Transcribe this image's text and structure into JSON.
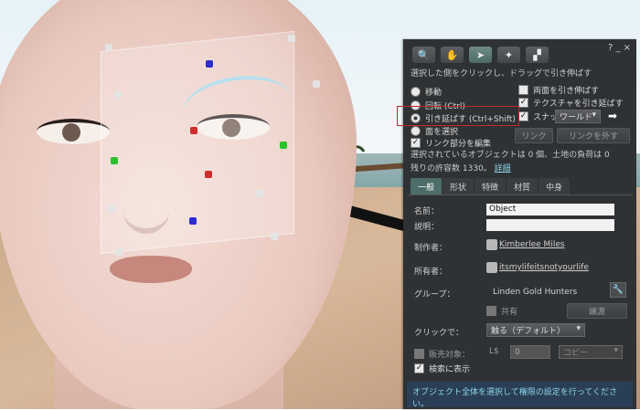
{
  "window": {
    "controls": "? _ ×"
  },
  "toolbar": {
    "tools": [
      {
        "icon": "magnifier-icon",
        "glyph": "🔍"
      },
      {
        "icon": "hand-icon",
        "glyph": "✋"
      },
      {
        "icon": "pointer-icon",
        "glyph": "➤"
      },
      {
        "icon": "wand-icon",
        "glyph": "✦"
      },
      {
        "icon": "land-icon",
        "glyph": "▞"
      }
    ]
  },
  "hint": "選択した側をクリックし、ドラッグで引き伸ばす",
  "modes": {
    "move": "移動",
    "rotate": "回転 (Ctrl)",
    "stretch": "引き延ばす (Ctrl+Shift)",
    "select_face": "面を選択"
  },
  "options": {
    "stretch_both": "両面を引き伸ばす",
    "stretch_textures": "テクスチャを引き延ばす",
    "snap": "スナップ",
    "snap_value": "ワールド",
    "edit_linked": "リンク部分を編集"
  },
  "buttons": {
    "link": "リンク",
    "unlink": "リンクを外す"
  },
  "info": {
    "line1": "選択されているオブジェクトは 0 個、土地の負荷は 0",
    "line2": "残りの許容数 1330。",
    "more": "詳細"
  },
  "tabs": [
    "一般",
    "形状",
    "特徴",
    "材質",
    "中身"
  ],
  "general": {
    "name_label": "名前：",
    "name_value": "Object",
    "desc_label": "説明：",
    "desc_value": "",
    "creator_label": "制作者：",
    "creator_value": "Kimberlee Miles",
    "owner_label": "所有者：",
    "owner_value": "itsmylifeitsnotyourlife",
    "group_label": "グループ：",
    "group_value": "Linden Gold Hunters",
    "share_label": "共有",
    "deed_label": "譲渡",
    "click_label": "クリックで：",
    "click_value": "触る（デフォルト）",
    "for_sale_label": "販売対象：",
    "currency": "L$",
    "price_value": "0",
    "sale_type": "コピー",
    "show_in_search": "検索に表示",
    "footer": "オブジェクト全体を選択して権限の設定を行ってください。"
  },
  "colors": {
    "panel_bg": "#2f3234",
    "link_color": "#8fd3e8",
    "highlight_border": "#c0282c",
    "active_tab": "#4d6d6a"
  }
}
